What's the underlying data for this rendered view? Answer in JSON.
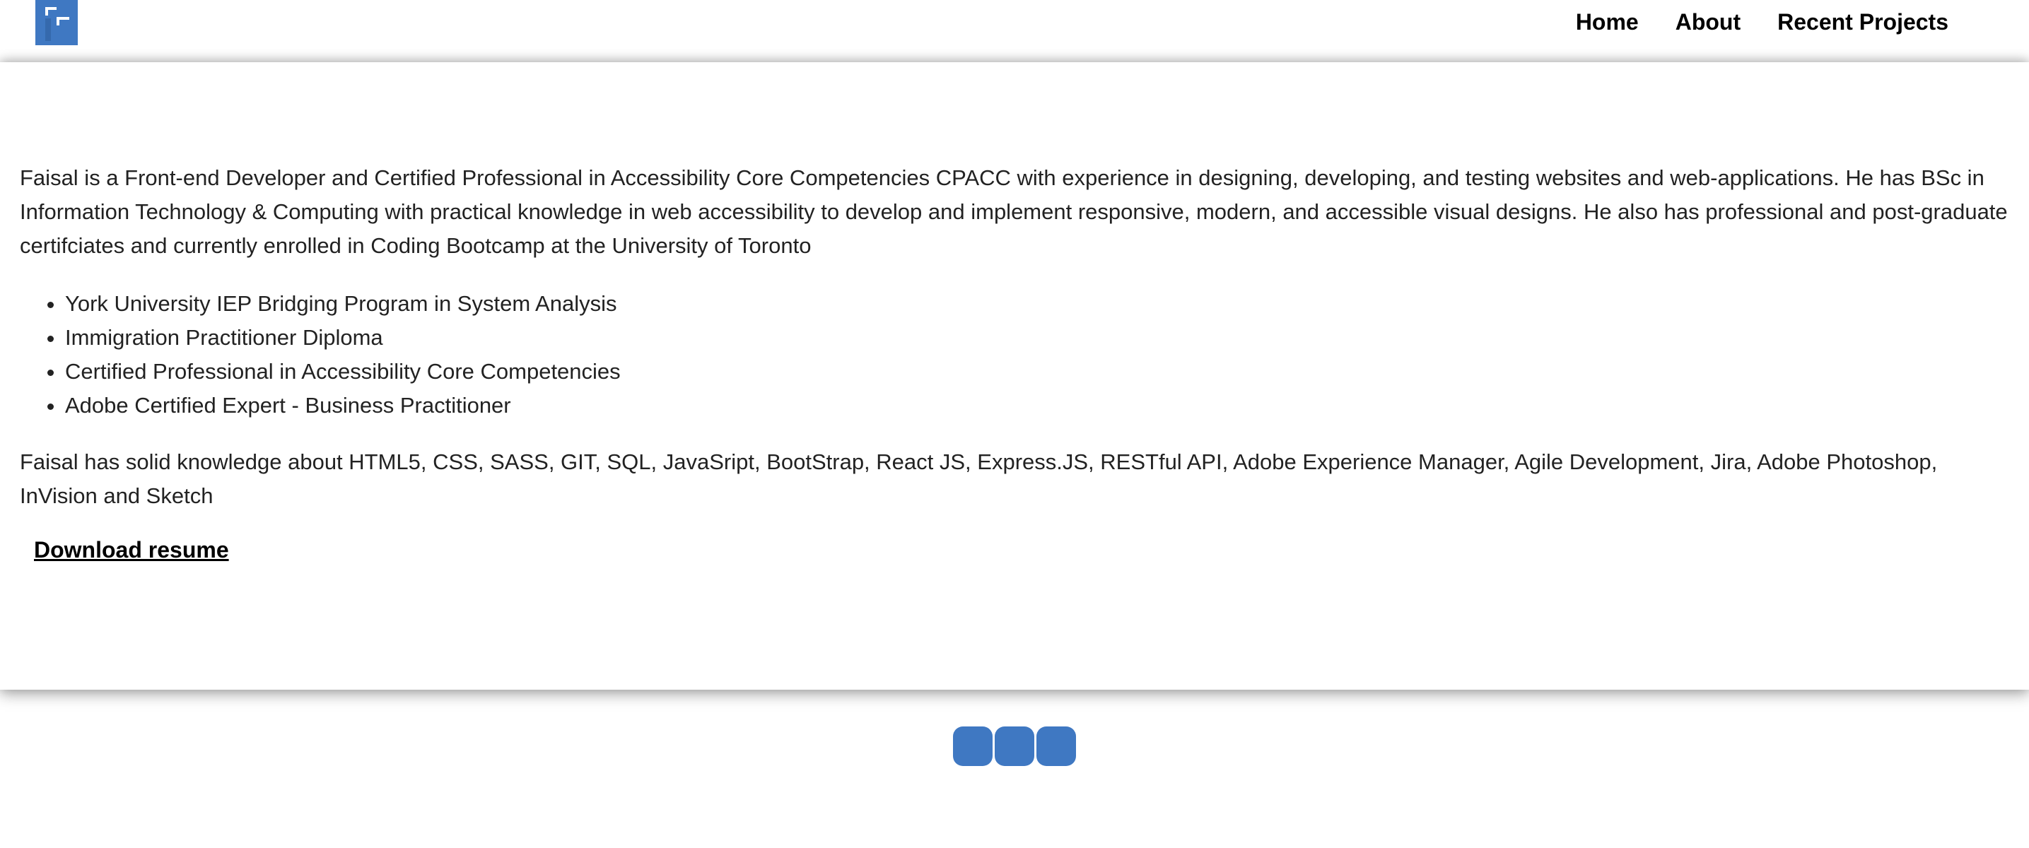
{
  "header": {
    "logo_label": "F",
    "nav": [
      {
        "label": "Home"
      },
      {
        "label": "About"
      },
      {
        "label": "Recent Projects"
      }
    ]
  },
  "about": {
    "intro": "Faisal is a Front-end Developer and Certified Professional in Accessibility Core Competencies CPACC with experience in designing, developing, and testing websites and web-applications. He has BSc in Information Technology & Computing with practical knowledge in web accessibility to develop and implement responsive, modern, and accessible visual designs. He also has professional and post-graduate certifciates and currently enrolled in Coding Bootcamp at the University of Toronto",
    "certificates": [
      "York University IEP Bridging Program in System Analysis",
      "Immigration Practitioner Diploma",
      "Certified Professional in Accessibility Core Competencies",
      "Adobe Certified Expert - Business Practitioner"
    ],
    "skills": "Faisal has solid knowledge about HTML5, CSS, SASS, GIT, SQL, JavaSript, BootStrap, React JS, Express.JS, RESTful API, Adobe Experience Manager, Agile Development, Jira, Adobe Photoshop, InVision and Sketch",
    "download_label": "Download resume"
  },
  "footer": {
    "social_links": [
      {
        "icon": "social-icon-1"
      },
      {
        "icon": "social-icon-2"
      },
      {
        "icon": "social-icon-3"
      }
    ]
  },
  "colors": {
    "accent": "#3f78c2",
    "text": "#222222"
  }
}
